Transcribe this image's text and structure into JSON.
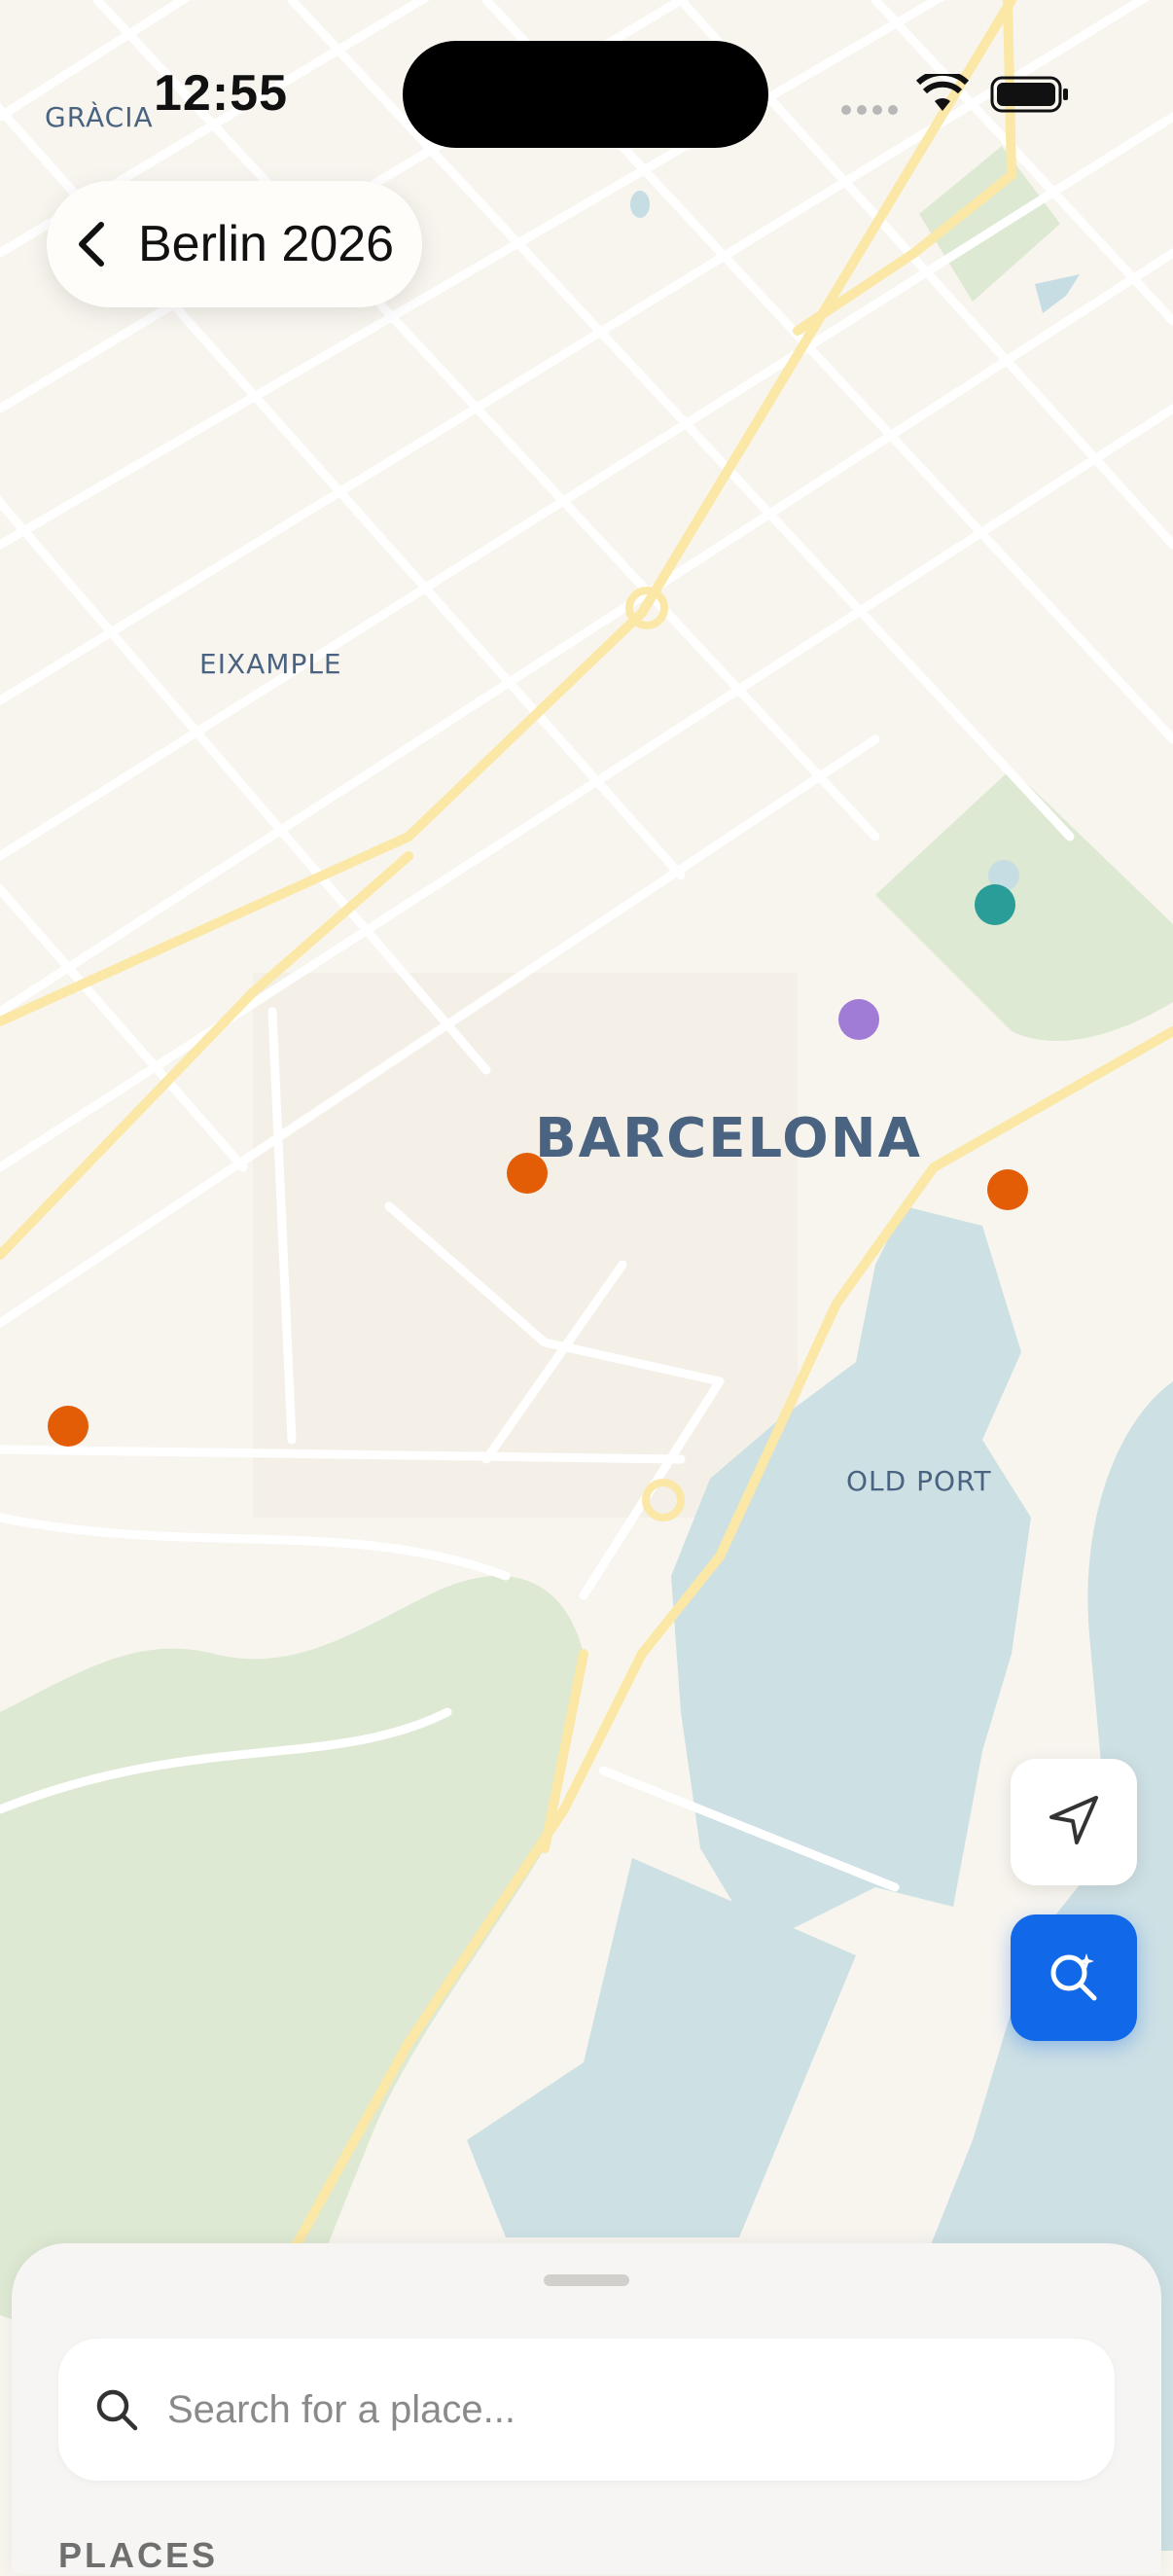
{
  "status_bar": {
    "time": "12:55",
    "wifi_icon": "wifi-icon",
    "battery_icon": "battery-icon",
    "signal_icon": "cellular-dots-icon"
  },
  "header": {
    "back_icon": "chevron-left-icon",
    "trip_title": "Berlin 2026"
  },
  "map": {
    "labels": {
      "gracia": "GRÀCIA",
      "eixample": "EIXAMPLE",
      "city": "BARCELONA",
      "old_port": "OLD PORT"
    },
    "pin_colors": {
      "orange": "#e35c06",
      "teal": "#2a9d98",
      "purple": "#a07cd6"
    }
  },
  "controls": {
    "locate_icon": "navigation-arrow-icon",
    "ai_search_icon": "sparkle-search-icon"
  },
  "sheet": {
    "search_placeholder": "Search for a place...",
    "search_icon": "search-icon",
    "section_title": "PLACES"
  },
  "colors": {
    "accent": "#1168e8",
    "map_bg": "#f8f5ef",
    "water": "#cde0e4",
    "park": "#dde9d3",
    "major_road": "#fbe7a6"
  }
}
